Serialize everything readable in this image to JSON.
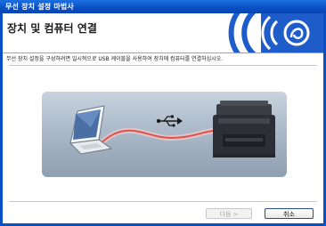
{
  "window": {
    "title": "무선 장치 설정 마법사"
  },
  "header": {
    "heading": "장치 및 컴퓨터 연결"
  },
  "body": {
    "description": "무선 장치 설정을 구성하려면 일시적으로 USB 케이블을 사용하여 장치에 컴퓨터를 연결하십시오."
  },
  "buttons": {
    "next_label": "다음 >",
    "cancel_label": "취소"
  },
  "illustration": {
    "left_icon": "laptop-icon",
    "center_icon": "usb-icon",
    "right_icon": "printer-icon",
    "cable_color": "#e0504a"
  },
  "colors": {
    "titlebar": "#0a4fc4",
    "logo": "#1d5cc9"
  }
}
